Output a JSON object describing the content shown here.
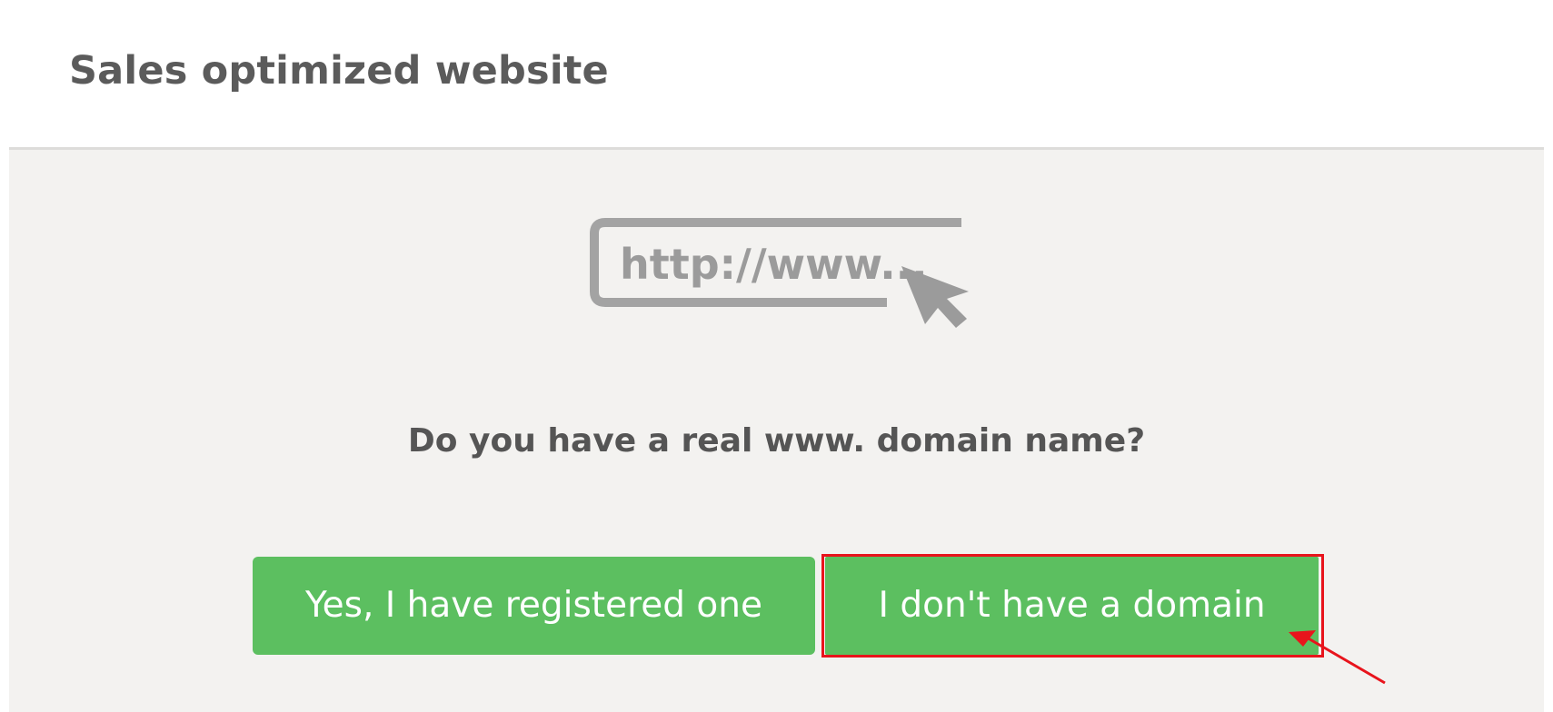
{
  "page": {
    "title": "Sales optimized website"
  },
  "domain_step": {
    "illustration_text": "http://www...",
    "question": "Do you have a real www. domain name?",
    "yes_button_label": "Yes, I have registered one",
    "no_button_label": "I don't have a domain"
  },
  "colors": {
    "button_green": "#5cbf60",
    "highlight_red": "#e8141c",
    "panel_background": "#f3f2f0",
    "title_gray": "#5b5b5b"
  },
  "icons": {
    "illustration": "url-bar-with-cursor-icon",
    "annotation": "red-pointer-arrow-icon"
  }
}
